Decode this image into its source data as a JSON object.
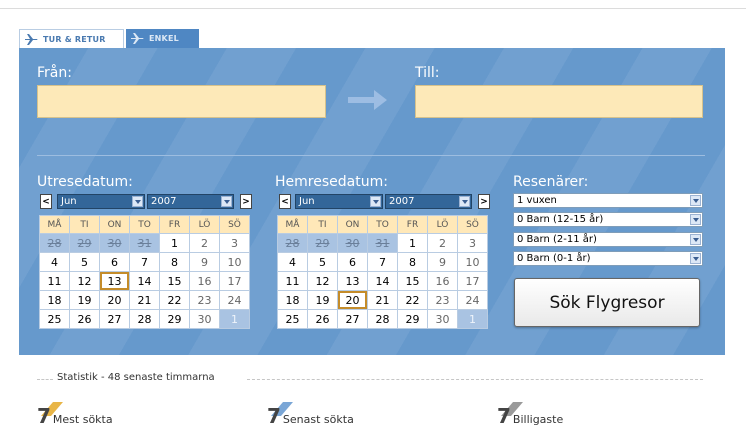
{
  "tabs": [
    {
      "label": "TUR & RETUR",
      "active": true
    },
    {
      "label": "ENKEL",
      "active": false
    }
  ],
  "from": {
    "label": "Från:",
    "value": ""
  },
  "to": {
    "label": "Till:",
    "value": ""
  },
  "outbound": {
    "label": "Utresedatum:",
    "prev": "<",
    "next": ">",
    "month": "Jun",
    "year": "2007",
    "weekdays": [
      "MÅ",
      "TI",
      "ON",
      "TO",
      "FR",
      "LÖ",
      "SÖ"
    ],
    "weeks": [
      [
        "28",
        "29",
        "30",
        "31",
        "1",
        "2",
        "3"
      ],
      [
        "4",
        "5",
        "6",
        "7",
        "8",
        "9",
        "10"
      ],
      [
        "11",
        "12",
        "13",
        "14",
        "15",
        "16",
        "17"
      ],
      [
        "18",
        "19",
        "20",
        "21",
        "22",
        "23",
        "24"
      ],
      [
        "25",
        "26",
        "27",
        "28",
        "29",
        "30",
        "1"
      ]
    ],
    "selected": "13"
  },
  "return": {
    "label": "Hemresedatum:",
    "prev": "<",
    "next": ">",
    "month": "Jun",
    "year": "2007",
    "weekdays": [
      "MÅ",
      "TI",
      "ON",
      "TO",
      "FR",
      "LÖ",
      "SÖ"
    ],
    "weeks": [
      [
        "28",
        "29",
        "30",
        "31",
        "1",
        "2",
        "3"
      ],
      [
        "4",
        "5",
        "6",
        "7",
        "8",
        "9",
        "10"
      ],
      [
        "11",
        "12",
        "13",
        "14",
        "15",
        "16",
        "17"
      ],
      [
        "18",
        "19",
        "20",
        "21",
        "22",
        "23",
        "24"
      ],
      [
        "25",
        "26",
        "27",
        "28",
        "29",
        "30",
        "1"
      ]
    ],
    "selected": "20"
  },
  "travelers": {
    "label": "Resenärer:",
    "adults": "1 vuxen",
    "children_12_15": "0 Barn (12-15 år)",
    "children_2_11": "0 Barn (2-11 år)",
    "infants": "0 Barn (0-1 år)"
  },
  "search_button": "Sök Flygresor",
  "stats": {
    "title": "Statistik - 48 senaste timmarna",
    "items": [
      {
        "num": "7",
        "label": "Mest sökta",
        "color": "#e8b547"
      },
      {
        "num": "7",
        "label": "Senast sökta",
        "color": "#7aa6d6"
      },
      {
        "num": "7",
        "label": "Billigaste",
        "color": "#9a9a9a"
      }
    ]
  },
  "colors": {
    "panel": "#6699cc",
    "field": "#fde9b8",
    "accent": "#336699"
  },
  "icons": {
    "tab_icon": "airplane-icon",
    "arrow": "arrow-right-icon"
  }
}
